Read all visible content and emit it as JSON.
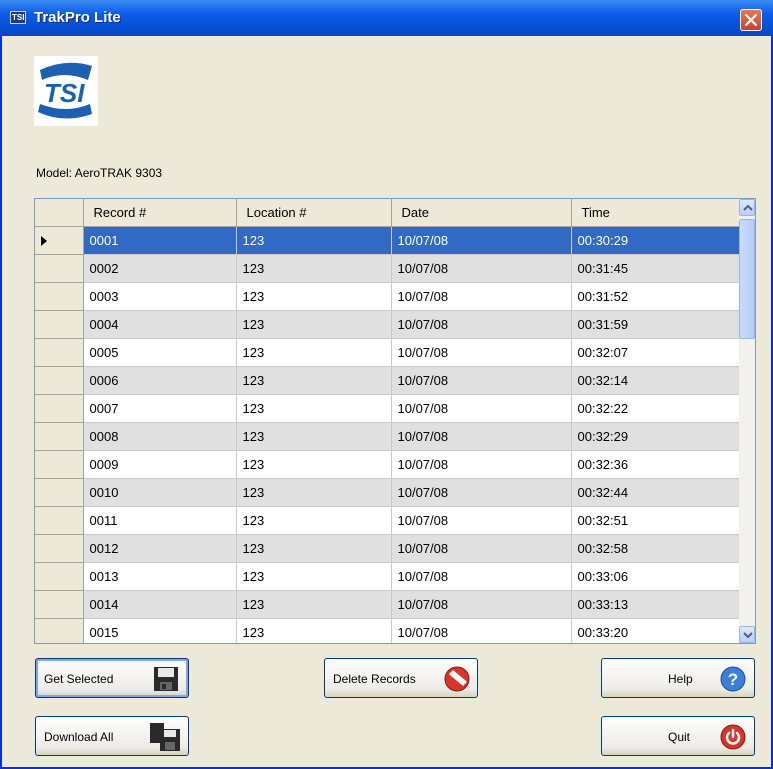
{
  "window": {
    "title": "TrakPro Lite",
    "app_icon_text": "TSI"
  },
  "logo": {
    "text": "TSI"
  },
  "model": {
    "label": "Model: AeroTRAK 9303"
  },
  "grid": {
    "columns": [
      "Record #",
      "Location #",
      "Date",
      "Time"
    ],
    "selected_index": 0,
    "rows": [
      {
        "record": "0001",
        "location": "123",
        "date": "10/07/08",
        "time": "00:30:29"
      },
      {
        "record": "0002",
        "location": "123",
        "date": "10/07/08",
        "time": "00:31:45"
      },
      {
        "record": "0003",
        "location": "123",
        "date": "10/07/08",
        "time": "00:31:52"
      },
      {
        "record": "0004",
        "location": "123",
        "date": "10/07/08",
        "time": "00:31:59"
      },
      {
        "record": "0005",
        "location": "123",
        "date": "10/07/08",
        "time": "00:32:07"
      },
      {
        "record": "0006",
        "location": "123",
        "date": "10/07/08",
        "time": "00:32:14"
      },
      {
        "record": "0007",
        "location": "123",
        "date": "10/07/08",
        "time": "00:32:22"
      },
      {
        "record": "0008",
        "location": "123",
        "date": "10/07/08",
        "time": "00:32:29"
      },
      {
        "record": "0009",
        "location": "123",
        "date": "10/07/08",
        "time": "00:32:36"
      },
      {
        "record": "0010",
        "location": "123",
        "date": "10/07/08",
        "time": "00:32:44"
      },
      {
        "record": "0011",
        "location": "123",
        "date": "10/07/08",
        "time": "00:32:51"
      },
      {
        "record": "0012",
        "location": "123",
        "date": "10/07/08",
        "time": "00:32:58"
      },
      {
        "record": "0013",
        "location": "123",
        "date": "10/07/08",
        "time": "00:33:06"
      },
      {
        "record": "0014",
        "location": "123",
        "date": "10/07/08",
        "time": "00:33:13"
      },
      {
        "record": "0015",
        "location": "123",
        "date": "10/07/08",
        "time": "00:33:20"
      }
    ]
  },
  "buttons": {
    "get_selected": "Get Selected",
    "download_all": "Download All",
    "delete_records": "Delete Records",
    "help": "Help",
    "quit": "Quit"
  },
  "icons": {
    "get_selected": "floppy-disk-icon",
    "download_all": "floppy-disks-icon",
    "delete_records": "delete-icon",
    "help": "help-icon",
    "quit": "power-icon"
  },
  "colors": {
    "title_bar": "#0A5BE8",
    "selection": "#316AC5",
    "alt_row": "#E0E0E0",
    "window_bg": "#ECE9D8"
  }
}
